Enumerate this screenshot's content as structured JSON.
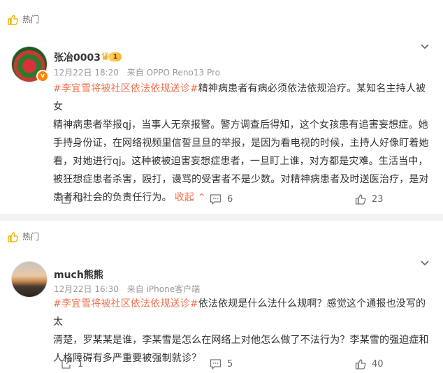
{
  "comments": [
    {
      "hot_label": "热门",
      "username": "张冶0003",
      "vip_level": "1",
      "date": "12月22日 18:20",
      "source": "来自 OPPO Reno13 Pro",
      "hashtag": "#李宜雪将被社区依法依规送诊#",
      "lines": [
        "精神病患者有病必须依法依规治疗。某知名主持人被女",
        "精神病患者举报qj，当事人无奈报警。警方调查后得知，这个女孩患有追害妄想症。她",
        "手持身份证，在网络视频里信誓旦旦的举报，是因为看电视的时候，主持人好像盯着她",
        "看，对她进行qj。这种被被迫害妄想症患者，一旦盯上谁，对方都是灾难。生活当中，",
        "被狂想症患者杀害，殴打，谩骂的受害者不是少数。对精神病患者及时送医治疗，是对",
        "患者和社会的负责任行为。"
      ],
      "collapse_label": "收起",
      "repost_count": "3",
      "comment_count": "6",
      "like_count": "23"
    },
    {
      "hot_label": "热门",
      "username": "much熊熊",
      "date": "12月22日 16:30",
      "source": "来自 iPhone客户端",
      "hashtag": "#李宜雪将被社区依法依规送诊#",
      "lines": [
        "依法依规是什么法什么规啊？感觉这个通报也没写的太",
        "清楚，罗某某是谁，李某雪是怎么在网络上对他怎么做了不法行为？李某雪的强迫症和",
        "人格障碍有多严重要被强制就诊？"
      ],
      "repost_count": "1",
      "comment_count": "5",
      "like_count": "40"
    }
  ],
  "colors": {
    "accent": "#eb7350",
    "hot_icon": "#f0b400",
    "vip": "#ff8200"
  },
  "icons": [
    "hot-thumb-icon",
    "chevron-down-icon",
    "repost-icon",
    "comment-icon",
    "like-icon",
    "v-badge-icon",
    "crown-icon"
  ]
}
